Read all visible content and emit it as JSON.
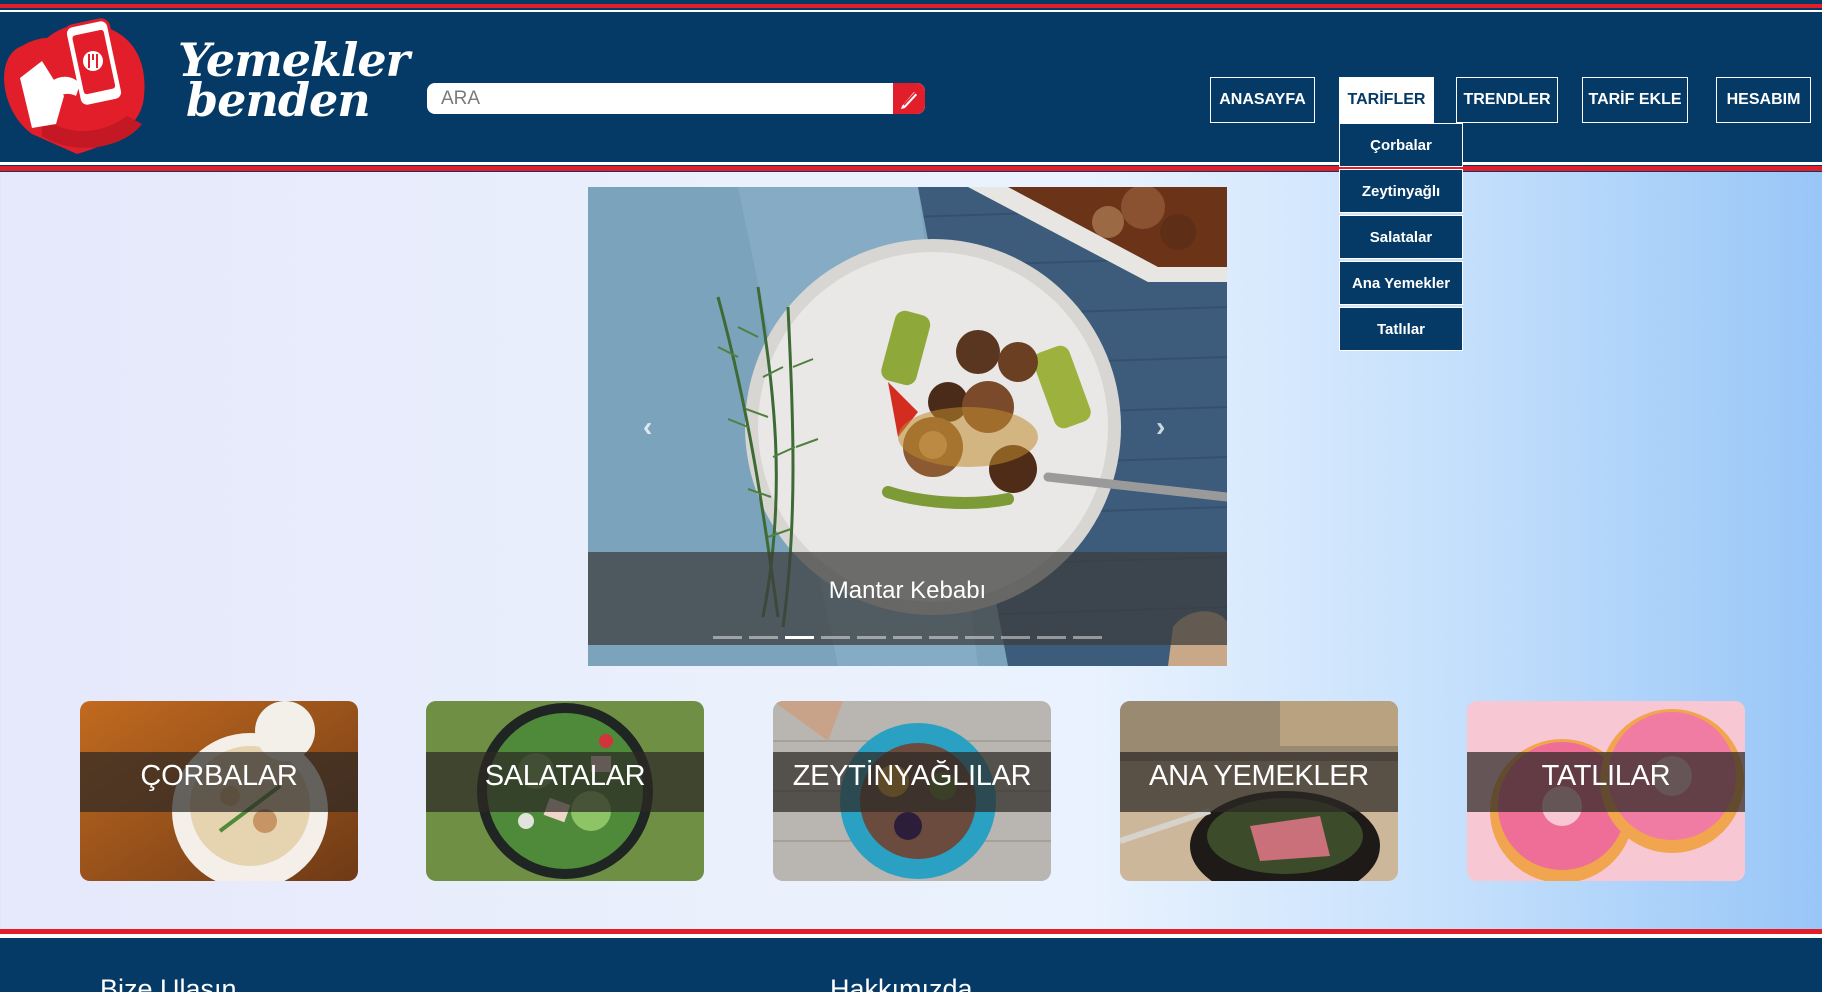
{
  "brand": {
    "line1": "Yemekler",
    "line2": "benden"
  },
  "search": {
    "placeholder": "ARA"
  },
  "nav": {
    "home": "ANASAYFA",
    "recipes": "TARİFLER",
    "trends": "TRENDLER",
    "add_recipe": "TARİF EKLE",
    "account": "HESABIM"
  },
  "dropdown": [
    "Çorbalar",
    "Zeytinyağlı",
    "Salatalar",
    "Ana Yemekler",
    "Tatlılar"
  ],
  "carousel": {
    "caption": "Mantar Kebabı",
    "slide_count": 11,
    "active_slide": 3
  },
  "categories": [
    "ÇORBALAR",
    "SALATALAR",
    "ZEYTİNYAĞLILAR",
    "ANA YEMEKLER",
    "TATLILAR"
  ],
  "footer": {
    "contact": "Bize Ulaşın",
    "about": "Hakkımızda"
  },
  "colors": {
    "navy": "#053a66",
    "red": "#e31e2b",
    "white": "#ffffff"
  },
  "icons": [
    "hand-phone-logo-icon",
    "pencil-search-icon",
    "chevron-left-icon",
    "chevron-right-icon"
  ]
}
